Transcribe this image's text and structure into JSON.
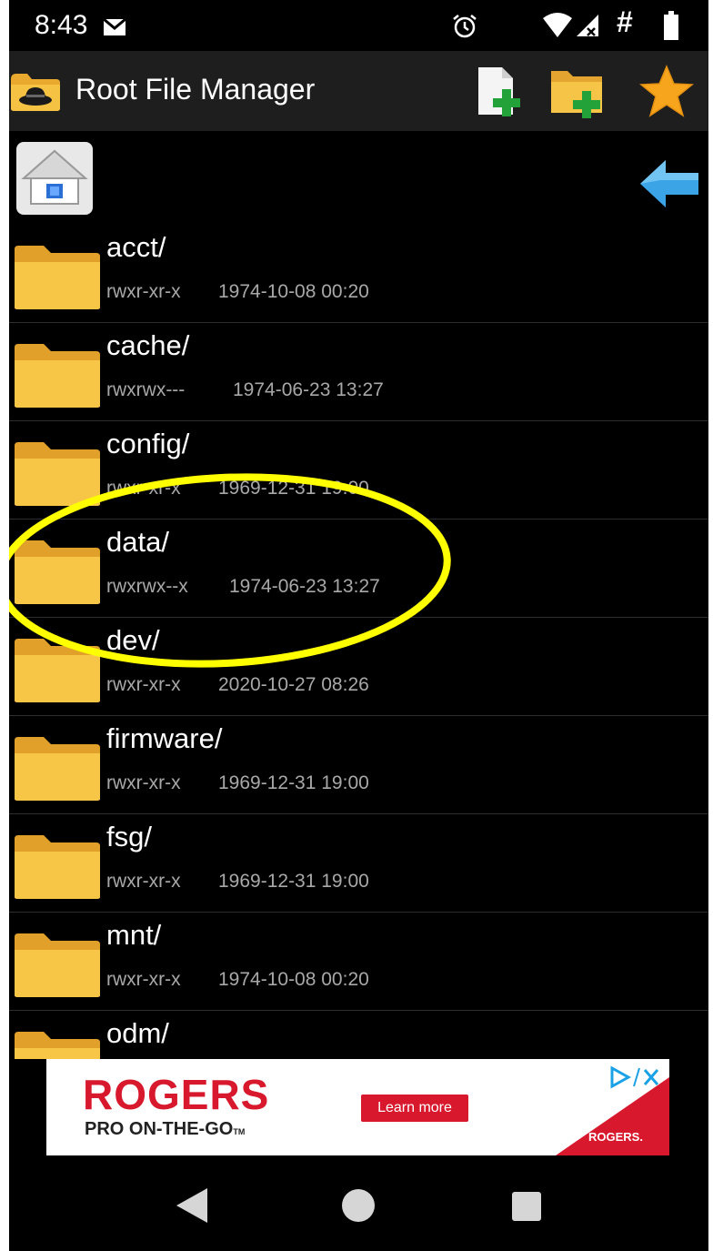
{
  "status_bar": {
    "time": "8:43",
    "extra_glyph": "#",
    "icons": [
      "mail-icon",
      "alarm-icon",
      "wifi-icon",
      "signal-icon",
      "battery-icon"
    ]
  },
  "action_bar": {
    "title": "Root File Manager",
    "buttons": [
      "new-file-button",
      "new-folder-button",
      "favorites-button"
    ]
  },
  "files": [
    {
      "name": "acct/",
      "perms": "rwxr-xr-x",
      "date": "1974-10-08 00:20"
    },
    {
      "name": "cache/",
      "perms": "rwxrwx---",
      "date": "1974-06-23 13:27"
    },
    {
      "name": "config/",
      "perms": "rwxr-xr-x",
      "date": "1969-12-31 19:00"
    },
    {
      "name": "data/",
      "perms": "rwxrwx--x",
      "date": "1974-06-23 13:27"
    },
    {
      "name": "dev/",
      "perms": "rwxr-xr-x",
      "date": "2020-10-27 08:26"
    },
    {
      "name": "firmware/",
      "perms": "rwxr-xr-x",
      "date": "1969-12-31 19:00"
    },
    {
      "name": "fsg/",
      "perms": "rwxr-xr-x",
      "date": "1969-12-31 19:00"
    },
    {
      "name": "mnt/",
      "perms": "rwxr-xr-x",
      "date": "1974-10-08 00:20"
    },
    {
      "name": "odm/",
      "perms": "",
      "date": ""
    }
  ],
  "ad": {
    "brand": "ROGERS",
    "tagline": "PRO ON-THE-GO",
    "trademark": "TM",
    "cta": "Learn more",
    "logo_text": "ROGERS."
  },
  "colors": {
    "accent_folder": "#f0b43a",
    "highlight": "#ffff00",
    "ad_red": "#d8182c"
  }
}
